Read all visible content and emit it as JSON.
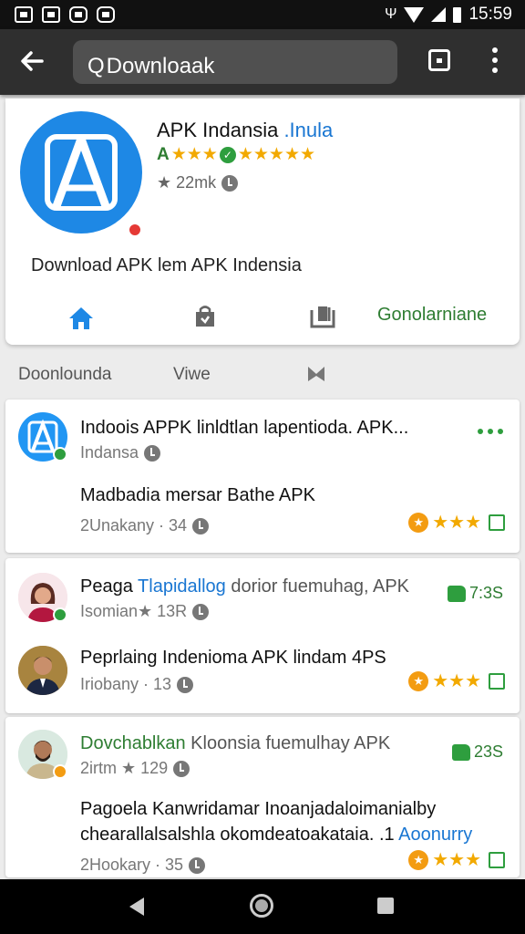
{
  "status_bar": {
    "time": "15:59"
  },
  "toolbar": {
    "search_value": "Downloaak",
    "search_prefix": "Q"
  },
  "hero": {
    "title_main": "APK Indansia ",
    "title_accent": ".Inula",
    "rating_prefix": "A",
    "rating_stars_left": "★★★",
    "rating_stars_right": "★★★★★",
    "meta": "★ 22mk",
    "description": "Download   APK lem  APK   Indensia",
    "tab_action": "Gonolarniane"
  },
  "filters": {
    "first": "Doonlounda",
    "second": "Viwe"
  },
  "cards": [
    {
      "title": "Indoois APPK linldtlan lapentioda. APK...",
      "sub": "Indansa",
      "body": "Madbadia mersar Bathe APK",
      "foot": "2Unakany · 34",
      "stars": "★★★"
    },
    {
      "rows": [
        {
          "title_a": "Peaga ",
          "title_b": "Tlapidallog",
          "title_c": " dorior fuemuhag, APK",
          "sub": "Isomian★ 13R",
          "likes": "7:3S"
        },
        {
          "title": "Peprlaing Indenioma APK lindam 4PS",
          "sub": "Iriobany · 13",
          "stars": "★★★"
        }
      ]
    },
    {
      "title_a": "Dovchablkan",
      "title_b": " Kloonsia fuemulhay APK",
      "sub": "2irtm ★ 129",
      "likes": "23S",
      "body_1": "Pagoela Kanwridamar Inoanjadaloimanialby",
      "body_2": "chearallalsalshla okomdeatoakataia. .1 ",
      "body_2_accent": "Aoonurry",
      "foot": "2Hookary · 35",
      "stars": "★★★"
    }
  ]
}
